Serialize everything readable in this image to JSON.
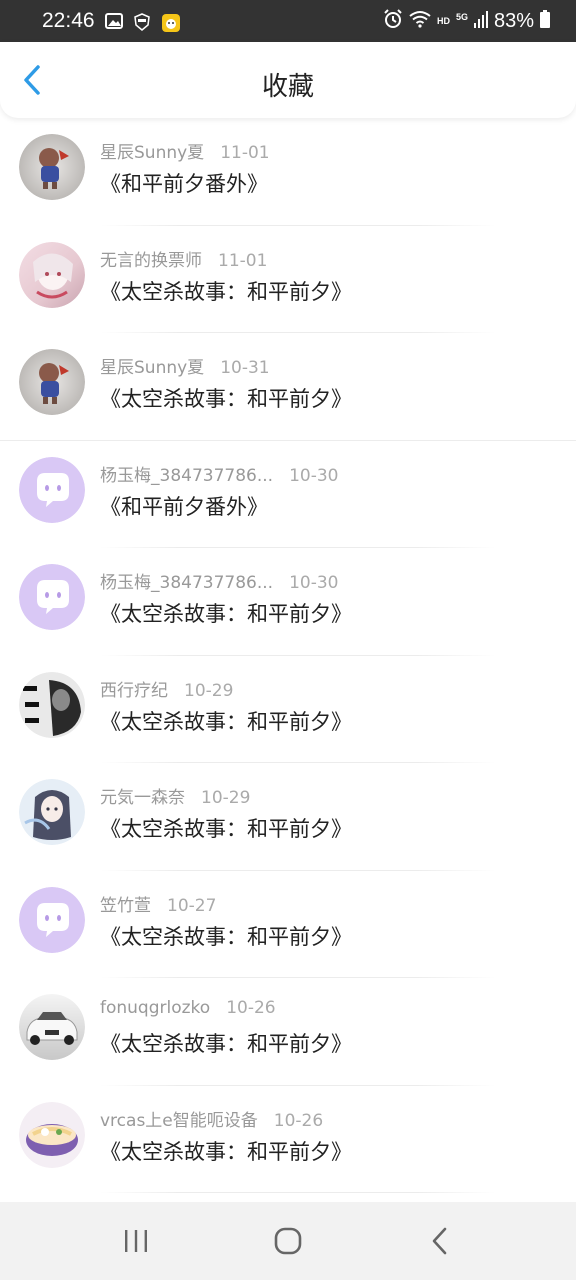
{
  "status_bar": {
    "time": "22:46",
    "battery_text": "83%",
    "network_label_1": "HD",
    "network_label_2": "5G"
  },
  "header": {
    "title": "收藏",
    "back_icon": "chevron-left-icon",
    "accent_color": "#2E9BE6"
  },
  "favorites": [
    {
      "user": "星辰Sunny夏",
      "time": "11-01",
      "title": "《和平前夕番外》",
      "avatar": "figure-avatar"
    },
    {
      "user": "无言的换票师",
      "time": "11-01",
      "title": "《太空杀故事：和平前夕》",
      "avatar": "anime-girl-avatar"
    },
    {
      "user": "星辰Sunny夏",
      "time": "10-31",
      "title": "《太空杀故事：和平前夕》",
      "avatar": "figure-avatar"
    },
    {
      "user": "杨玉梅_384737786...",
      "time": "10-30",
      "title": "《和平前夕番外》",
      "avatar": "default-chat-avatar"
    },
    {
      "user": "杨玉梅_384737786...",
      "time": "10-30",
      "title": "《太空杀故事：和平前夕》",
      "avatar": "default-chat-avatar"
    },
    {
      "user": "西行疗纪",
      "time": "10-29",
      "title": "《太空杀故事：和平前夕》",
      "avatar": "photo-text-avatar"
    },
    {
      "user": "元気一森奈",
      "time": "10-29",
      "title": "《太空杀故事：和平前夕》",
      "avatar": "anime-girl-avatar"
    },
    {
      "user": "笠竹萱",
      "time": "10-27",
      "title": "《太空杀故事：和平前夕》",
      "avatar": "default-chat-avatar"
    },
    {
      "user": "fonuqgrlozko",
      "time": "10-26",
      "title": "《太空杀故事：和平前夕》",
      "avatar": "car-avatar"
    },
    {
      "user": "vrcas上e智能呃设备",
      "time": "10-26",
      "title": "《太空杀故事：和平前夕》",
      "avatar": "food-bowl-avatar"
    }
  ],
  "nav_bar": {
    "recents_icon": "recent-apps-icon",
    "home_icon": "home-icon",
    "back_icon": "back-icon"
  }
}
